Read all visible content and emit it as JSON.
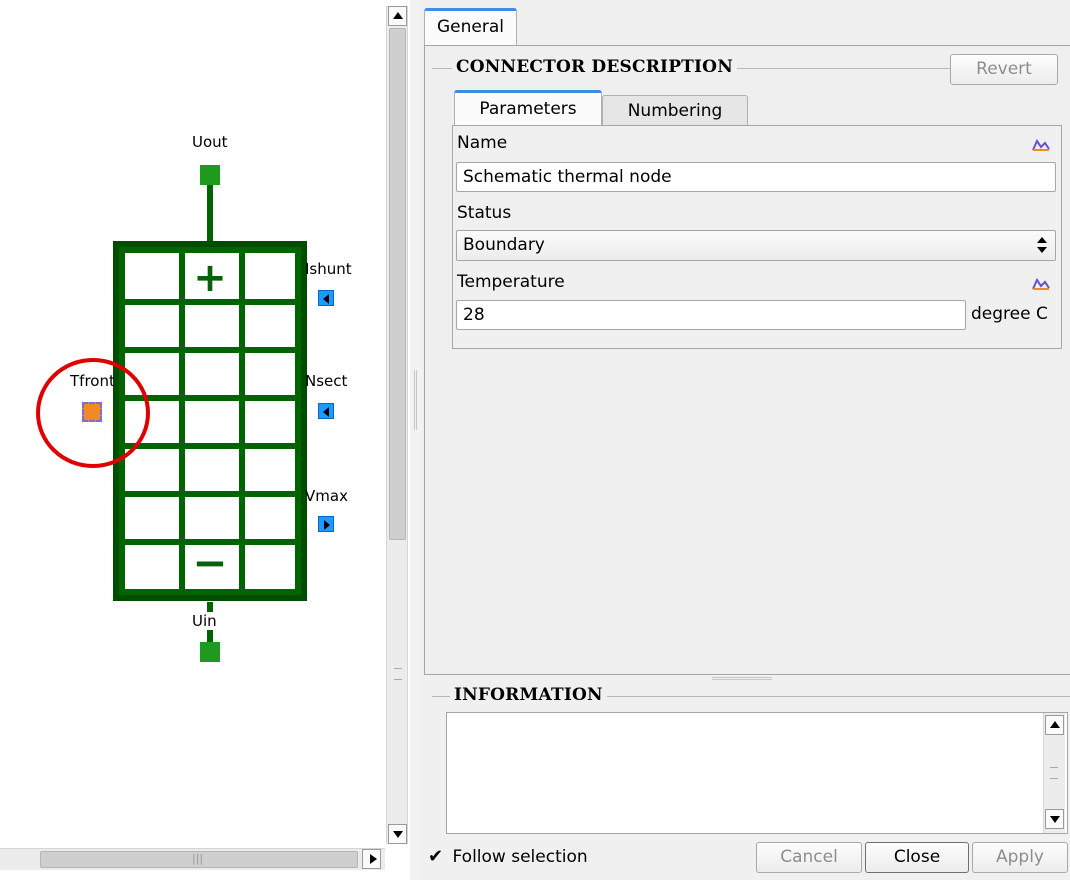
{
  "schematic": {
    "pins": {
      "top": "Uout",
      "bottom": "Uin",
      "left": "Tfront",
      "right1": "Ishunt",
      "right2": "Nsect",
      "right3": "Vmax"
    },
    "plus_symbol": "+",
    "minus_symbol": "−"
  },
  "tabs": {
    "general": "General"
  },
  "connector_description": {
    "title": "CONNECTOR DESCRIPTION",
    "revert_label": "Revert",
    "subtabs": [
      "Parameters",
      "Numbering"
    ],
    "fields": {
      "name_label": "Name",
      "name_value": "Schematic thermal node",
      "status_label": "Status",
      "status_value": "Boundary",
      "temperature_label": "Temperature",
      "temperature_value": "28",
      "temperature_unit": "degree C"
    }
  },
  "information": {
    "title": "INFORMATION"
  },
  "footer": {
    "follow_selection_label": "Follow selection",
    "follow_selection_checked": true,
    "cancel_label": "Cancel",
    "close_label": "Close",
    "apply_label": "Apply"
  },
  "colors": {
    "block_green": "#006400",
    "pin_green": "#1f9a1f",
    "pin_blue": "#1a9bff",
    "pin_orange": "#f08a24",
    "highlight_red": "#e10000",
    "tab_accent": "#3a8ee6"
  },
  "icons": {
    "plot": "chart-line-icon",
    "check": "checkmark-icon"
  },
  "scrollbar": {
    "grip_marks": "|||"
  }
}
